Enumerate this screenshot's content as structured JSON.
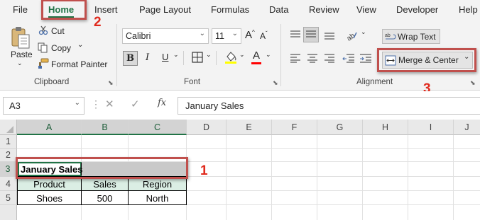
{
  "menu": {
    "file": "File",
    "home": "Home",
    "insert": "Insert",
    "page_layout": "Page Layout",
    "formulas": "Formulas",
    "data": "Data",
    "review": "Review",
    "view": "View",
    "developer": "Developer",
    "help": "Help"
  },
  "ribbon": {
    "clipboard": {
      "paste": "Paste",
      "cut": "Cut",
      "copy": "Copy",
      "format_painter": "Format Painter",
      "label": "Clipboard"
    },
    "font": {
      "name": "Calibri",
      "size": "11",
      "bold": "B",
      "italic": "I",
      "underline": "U",
      "grow": "A",
      "shrink": "A",
      "font_color": "A",
      "label": "Font",
      "fill_color_hex": "#ffff00",
      "font_color_hex": "#ff0000"
    },
    "alignment": {
      "wrap_text": "Wrap Text",
      "merge_center": "Merge & Center",
      "label": "Alignment"
    }
  },
  "formula_bar": {
    "name_box": "A3",
    "fx": "fx",
    "content": "January Sales"
  },
  "grid": {
    "columns": [
      "A",
      "B",
      "C",
      "D",
      "E",
      "F",
      "G",
      "H",
      "I",
      "J"
    ],
    "rows": [
      "1",
      "2",
      "3",
      "4",
      "5"
    ],
    "a3": "January Sales",
    "headers": [
      "Product",
      "Sales",
      "Region"
    ],
    "row5": [
      "Shoes",
      "500",
      "North"
    ]
  },
  "callouts": {
    "one": "1",
    "two": "2",
    "three": "3"
  },
  "colors": {
    "accent": "#217346",
    "callout": "#c0504d",
    "callout_number": "#e02a1d",
    "header_fill": "#dbeee4",
    "selection_fill": "#c9c9c9"
  }
}
